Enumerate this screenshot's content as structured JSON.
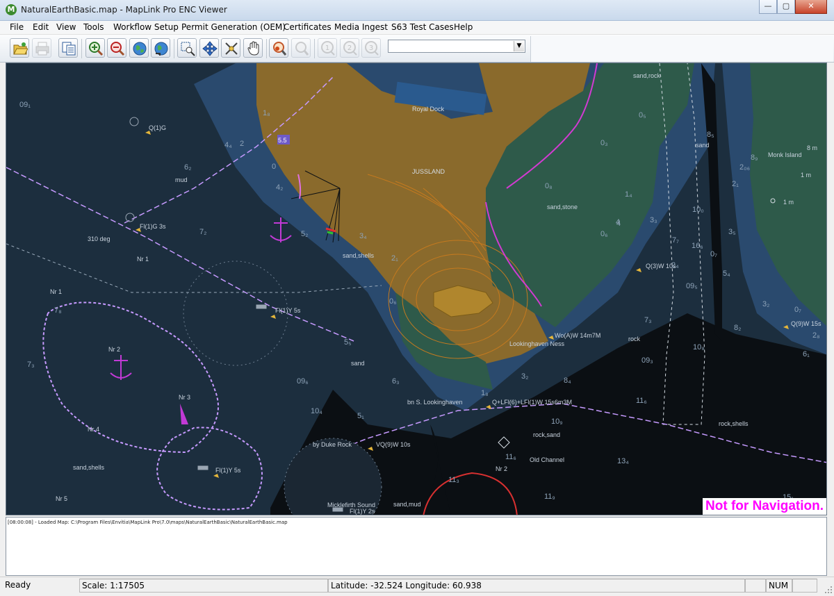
{
  "window": {
    "title": "NaturalEarthBasic.map - MapLink Pro ENC Viewer",
    "app_icon_letter": "M",
    "minimize": "—",
    "maximize": "▢",
    "close": "✕"
  },
  "menu": [
    "File",
    "Edit",
    "View",
    "Tools",
    "Workflow Setup",
    "Permit Generation (OEM)",
    "Certificates",
    "Media Ingest",
    "S63 Test Cases",
    "Help"
  ],
  "toolbar": {
    "buttons": [
      {
        "name": "open-map-button",
        "icon": "folder-open-icon",
        "enabled": true
      },
      {
        "name": "print-button",
        "icon": "printer-icon",
        "enabled": false
      },
      {
        "name": "copy-button",
        "icon": "copy-icon",
        "enabled": true
      },
      {
        "name": "zoom-in-button",
        "icon": "zoom-in-icon",
        "enabled": true
      },
      {
        "name": "zoom-out-button",
        "icon": "zoom-out-icon",
        "enabled": true
      },
      {
        "name": "world-view-button",
        "icon": "globe-icon",
        "enabled": true
      },
      {
        "name": "reset-view-button",
        "icon": "globe-refresh-icon",
        "enabled": true
      },
      {
        "name": "zoom-rectangle-button",
        "icon": "zoom-rectangle-icon",
        "enabled": true
      },
      {
        "name": "pan-button",
        "icon": "move-arrows-icon",
        "enabled": true
      },
      {
        "name": "measure-button",
        "icon": "measure-icon",
        "enabled": true
      },
      {
        "name": "grab-pan-button",
        "icon": "hand-icon",
        "enabled": true
      },
      {
        "name": "query-button",
        "icon": "query-magnifier-icon",
        "enabled": true
      },
      {
        "name": "query-disabled-button",
        "icon": "magnifier-disabled-icon",
        "enabled": false
      },
      {
        "name": "preset-1-button",
        "icon": "preset-1-icon",
        "label": "1",
        "enabled": false
      },
      {
        "name": "preset-2-button",
        "icon": "preset-2-icon",
        "label": "2",
        "enabled": false
      },
      {
        "name": "preset-3-button",
        "icon": "preset-3-icon",
        "label": "3",
        "enabled": false
      }
    ],
    "combo_value": ""
  },
  "map": {
    "warning": "Not for Navigation.",
    "labels": [
      "Royal Dock",
      "JUSSLAND",
      "sand,rock",
      "sand",
      "Monk Island",
      "sand,stone",
      "mud",
      "310 deg",
      "Nr 1",
      "Fl(1)G 3s",
      "Q(1)G",
      "sand,shells",
      "Nr 1",
      "Fl(1)Y 5s",
      "Nr 2",
      "Nr 3",
      "Nr 4",
      "Nr 5",
      "sand",
      "sand,shells",
      "Fl(1)Y 5s",
      "by Duke Rock",
      "VQ(9)W 10s",
      "Micklefirth Sound",
      "sand,mud",
      "Fl(1)Y 2s",
      "bn S. Lookinghaven",
      "Q+LFl(6)+LFl(1)W 15s6m3M",
      "rock,sand",
      "Old Channel",
      "Nr 2",
      "Wo(A)W 14m7M",
      "Lookinghaven Ness",
      "rock",
      "Q(3)W 10s",
      "Q(9)W 15s",
      "rock,shells",
      "1 m",
      "1 m",
      "8 m",
      "5.5"
    ],
    "depths": [
      "09₁",
      "6₂",
      "4₄",
      "2",
      "0",
      "4₂",
      "7₂",
      "5₂",
      "3₄",
      "2₁",
      "0₆",
      "5₅",
      "6₃",
      "09₆",
      "10₄",
      "3₂",
      "5₁",
      "8₄",
      "11₆",
      "13₄",
      "10₉",
      "11₃",
      "11₉",
      "09₃",
      "11₆",
      "7₃",
      "10₈",
      "8₂",
      "6₁",
      "15₁",
      "0₅",
      "0₃",
      "0₈",
      "0₆",
      "4",
      "3₃",
      "7₇",
      "8₅",
      "10₀",
      "16₆",
      "2₁",
      "3₅",
      "3₂",
      "0₇",
      "2₈",
      "5₄",
      "1₄",
      "0₇",
      "8₉",
      "7₈",
      "4",
      "7₃",
      "1₈",
      "09₅",
      "2₄",
      "1₈",
      "2₀₆"
    ]
  },
  "log": {
    "line": "[08:00:08] - Loaded Map: C:\\Program Files\\Envitia\\MapLink Pro\\7.0\\maps\\NaturalEarthBasic\\NaturalEarthBasic.map"
  },
  "status": {
    "ready": "Ready",
    "scale": "Scale: 1:17505",
    "coords": "Latitude: -32.524  Longitude: 60.938",
    "num": "NUM"
  },
  "colors": {
    "map_deep": "#1c2e3e",
    "land": "#8a6a2c",
    "green": "#2e5a4a",
    "shallow": "#2a4a6e",
    "warning": "#ff00ff",
    "route": "#c69aff"
  }
}
